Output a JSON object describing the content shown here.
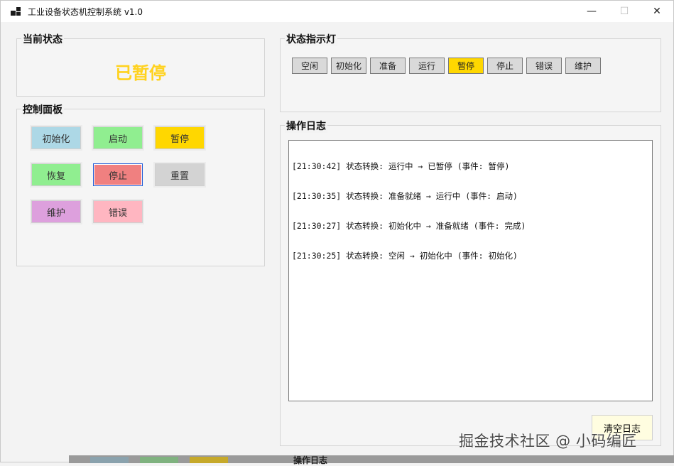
{
  "window": {
    "title": "工业设备状态机控制系统 v1.0",
    "minimize": "—",
    "maximize": "☐",
    "close": "✕"
  },
  "current_state": {
    "title": "当前状态",
    "value": "已暂停",
    "color": "#ffd21f"
  },
  "control_panel": {
    "title": "控制面板",
    "buttons": [
      {
        "label": "初始化",
        "color": "#add8e6"
      },
      {
        "label": "启动",
        "color": "#90ee90"
      },
      {
        "label": "暂停",
        "color": "#ffd700"
      },
      {
        "label": "恢复",
        "color": "#90ee90"
      },
      {
        "label": "停止",
        "color": "#f08080"
      },
      {
        "label": "重置",
        "color": "#d3d3d3"
      },
      {
        "label": "维护",
        "color": "#dda0dd"
      },
      {
        "label": "错误",
        "color": "#ffb6c1"
      }
    ]
  },
  "indicators": {
    "title": "状态指示灯",
    "items": [
      {
        "label": "空闲",
        "active": false
      },
      {
        "label": "初始化",
        "active": false
      },
      {
        "label": "准备",
        "active": false
      },
      {
        "label": "运行",
        "active": false
      },
      {
        "label": "暂停",
        "active": true
      },
      {
        "label": "停止",
        "active": false
      },
      {
        "label": "错误",
        "active": false
      },
      {
        "label": "维护",
        "active": false
      }
    ],
    "active_color": "#ffd700",
    "inactive_color": "#d9d9d9"
  },
  "log": {
    "title": "操作日志",
    "lines": [
      "[21:30:42] 状态转换: 运行中 → 已暂停 (事件: 暂停)",
      "[21:30:35] 状态转换: 准备就绪 → 运行中 (事件: 启动)",
      "[21:30:27] 状态转换: 初始化中 → 准备就绪 (事件: 完成)",
      "[21:30:25] 状态转换: 空闲 → 初始化中 (事件: 初始化)"
    ],
    "clear_label": "清空日志"
  },
  "background_window": {
    "label": "操作日志"
  },
  "watermark": "掘金技术社区 @ 小码编匠"
}
